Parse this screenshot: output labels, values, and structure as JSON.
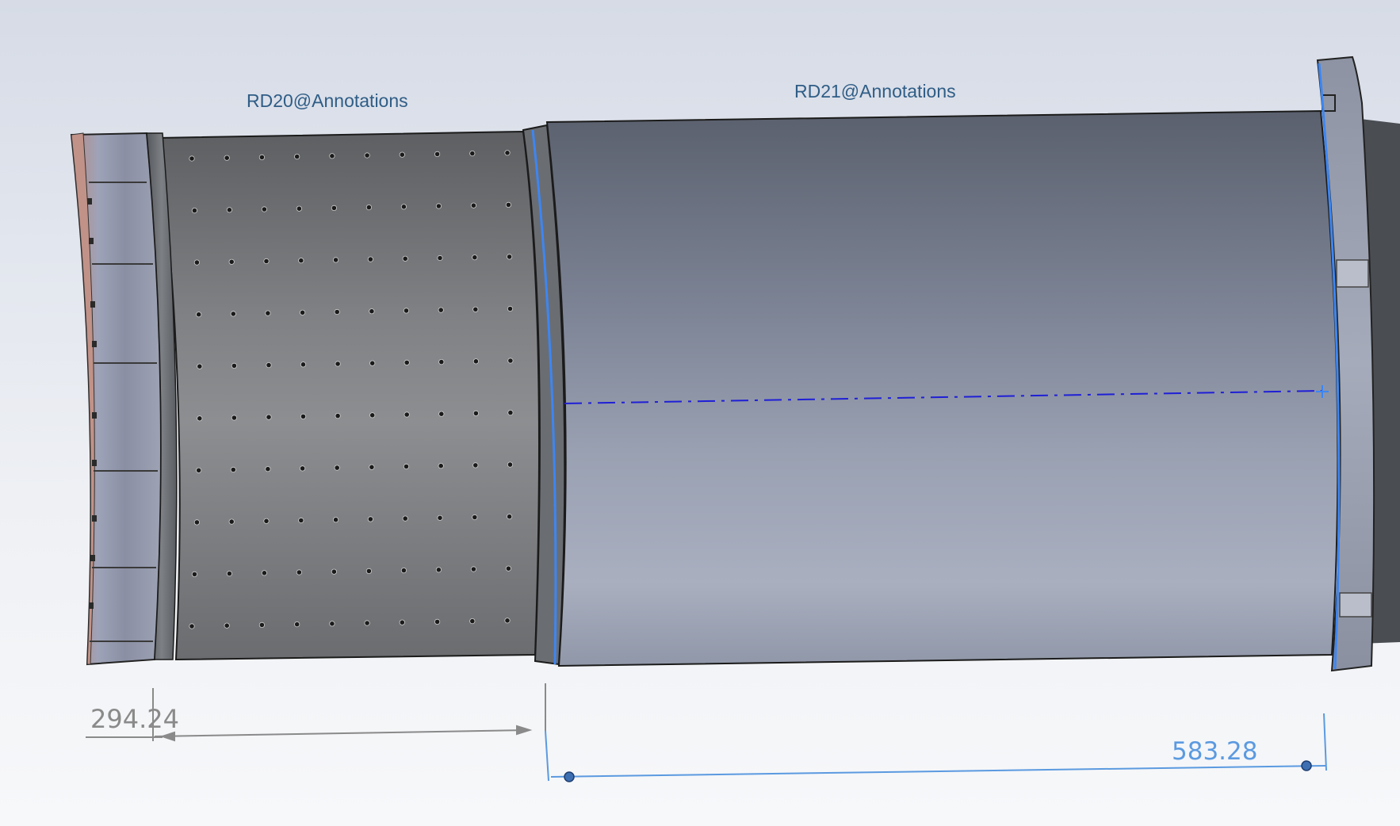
{
  "viewport": {
    "annotations": [
      {
        "label": "RD20@Annotations"
      },
      {
        "label": "RD21@Annotations"
      }
    ],
    "dimensions": [
      {
        "value": "294.24",
        "color": "#8a8a8a"
      },
      {
        "value": "583.28",
        "color": "#5b9ae0"
      }
    ],
    "colors": {
      "background_top": "#d6dbe6",
      "background_bottom": "#f7f8fa",
      "perforated_shell": "#7b7d80",
      "smooth_shell": "#8e96a8",
      "selection_highlight": "#3d86f2",
      "centerline": "#1f1fd6",
      "reference_dimension": "#8a8a8a",
      "driven_dimension": "#5b9ae0"
    }
  }
}
